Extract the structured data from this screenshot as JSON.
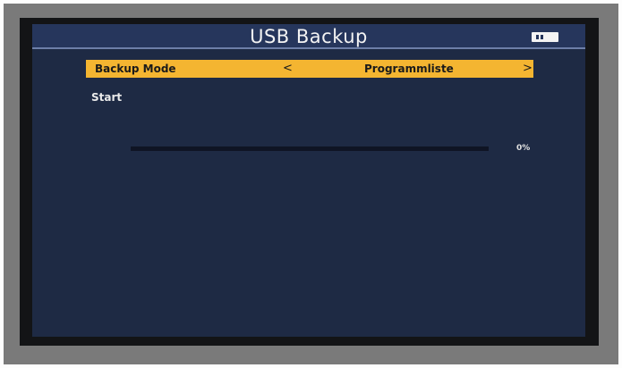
{
  "screen": {
    "title": "USB Backup",
    "battery_icon": "battery-icon"
  },
  "menu": {
    "backup_mode": {
      "label": "Backup Mode",
      "arrow_left": "<",
      "value": "Programmliste",
      "arrow_right": ">"
    },
    "start": {
      "label": "Start"
    }
  },
  "progress": {
    "percent": 0,
    "text": "0%"
  },
  "colors": {
    "highlight": "#f4b531",
    "background": "#1e2a44",
    "titlebar": "#26365c"
  }
}
